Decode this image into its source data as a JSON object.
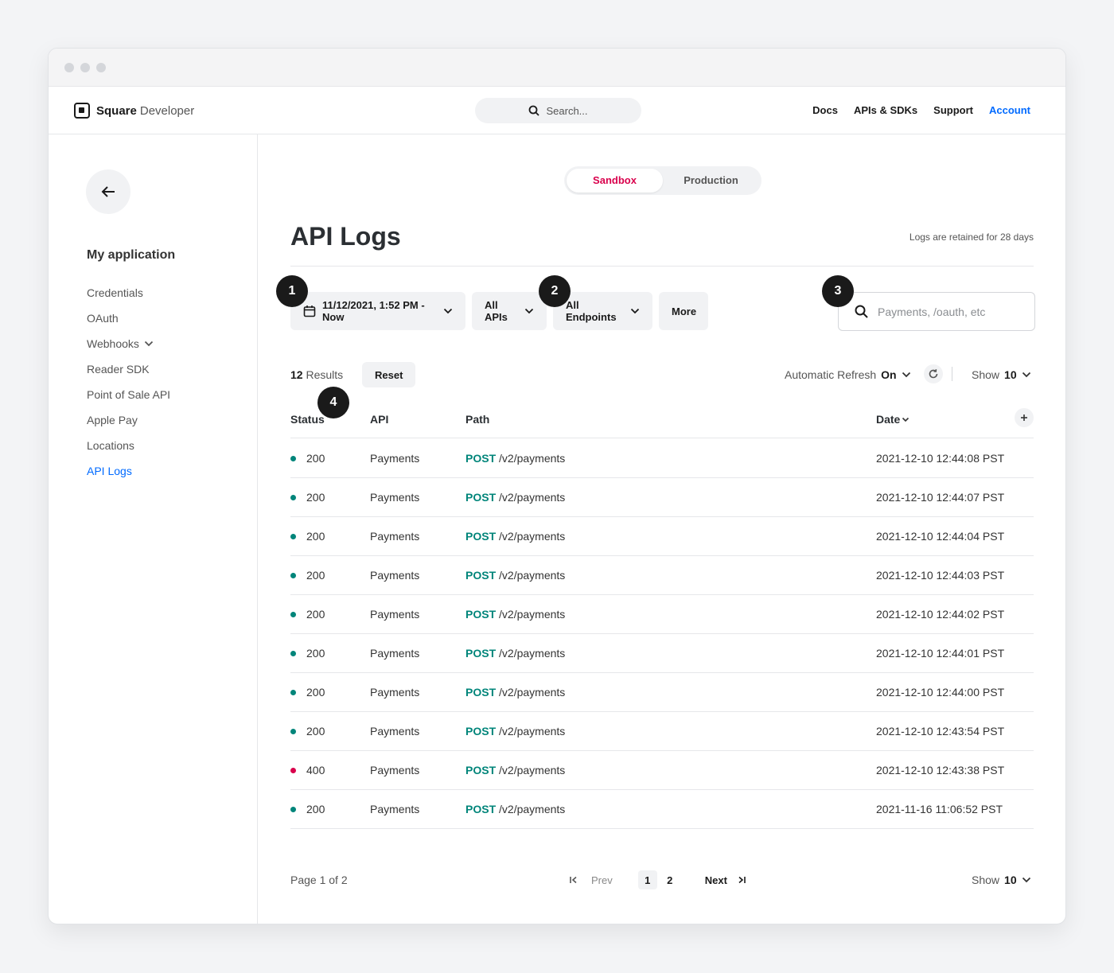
{
  "window": {
    "traffic_lights": [
      "close",
      "minimize",
      "maximize"
    ]
  },
  "topnav": {
    "brand": "Square",
    "brand_sub": "Developer",
    "search_placeholder": "Search...",
    "links": [
      "Docs",
      "APIs & SDKs",
      "Support",
      "Account"
    ]
  },
  "sidebar": {
    "title": "My application",
    "items": [
      {
        "label": "Credentials"
      },
      {
        "label": "OAuth"
      },
      {
        "label": "Webhooks"
      },
      {
        "label": "Reader SDK"
      },
      {
        "label": "Point of Sale API"
      },
      {
        "label": "Apple Pay"
      },
      {
        "label": "Locations"
      },
      {
        "label": "API Logs",
        "active": true
      }
    ]
  },
  "env_toggle": {
    "options": [
      "Sandbox",
      "Production"
    ],
    "selected": "Sandbox"
  },
  "page": {
    "title": "API Logs",
    "retention_note": "Logs are retained for 28 days"
  },
  "filters": {
    "date_range": "11/12/2021, 1:52 PM - Now",
    "api": "All APIs",
    "endpoint": "All Endpoints",
    "more": "More",
    "search_placeholder": "Payments, /oauth, etc"
  },
  "callouts": [
    "1",
    "2",
    "3",
    "4"
  ],
  "results": {
    "count": "12",
    "label": "Results",
    "reset": "Reset"
  },
  "refresh": {
    "label": "Automatic Refresh",
    "state": "On"
  },
  "show": {
    "label": "Show",
    "value": "10"
  },
  "table": {
    "columns": [
      "Status",
      "API",
      "Path",
      "Date"
    ],
    "rows": [
      {
        "status": "200",
        "api": "Payments",
        "method": "POST",
        "path": "/v2/payments",
        "date": "2021-12-10 12:44:08 PST"
      },
      {
        "status": "200",
        "api": "Payments",
        "method": "POST",
        "path": "/v2/payments",
        "date": "2021-12-10 12:44:07 PST"
      },
      {
        "status": "200",
        "api": "Payments",
        "method": "POST",
        "path": "/v2/payments",
        "date": "2021-12-10 12:44:04 PST"
      },
      {
        "status": "200",
        "api": "Payments",
        "method": "POST",
        "path": "/v2/payments",
        "date": "2021-12-10 12:44:03 PST"
      },
      {
        "status": "200",
        "api": "Payments",
        "method": "POST",
        "path": "/v2/payments",
        "date": "2021-12-10 12:44:02 PST"
      },
      {
        "status": "200",
        "api": "Payments",
        "method": "POST",
        "path": "/v2/payments",
        "date": "2021-12-10 12:44:01 PST"
      },
      {
        "status": "200",
        "api": "Payments",
        "method": "POST",
        "path": "/v2/payments",
        "date": "2021-12-10 12:44:00 PST"
      },
      {
        "status": "200",
        "api": "Payments",
        "method": "POST",
        "path": "/v2/payments",
        "date": "2021-12-10 12:43:54 PST"
      },
      {
        "status": "400",
        "api": "Payments",
        "method": "POST",
        "path": "/v2/payments",
        "date": "2021-12-10 12:43:38 PST"
      },
      {
        "status": "200",
        "api": "Payments",
        "method": "POST",
        "path": "/v2/payments",
        "date": "2021-11-16 11:06:52 PST"
      }
    ]
  },
  "status_colors": {
    "200": "#00857a",
    "400": "#d9004c"
  },
  "pagination": {
    "info": "Page 1 of 2",
    "prev": "Prev",
    "next": "Next",
    "pages": [
      "1",
      "2"
    ],
    "current": "1"
  }
}
